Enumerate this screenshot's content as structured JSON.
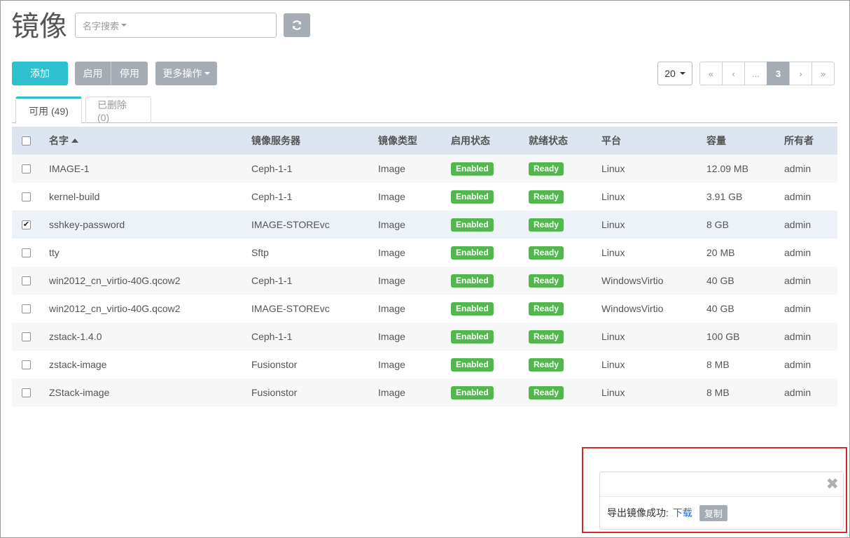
{
  "header": {
    "title": "镜像",
    "search_placeholder": "名字搜索",
    "refresh_icon": "refresh-icon"
  },
  "toolbar": {
    "add_label": "添加",
    "enable_label": "启用",
    "disable_label": "停用",
    "more_label": "更多操作"
  },
  "pagination": {
    "page_size": "20",
    "first": "«",
    "prev": "‹",
    "ellipsis": "...",
    "current": "3",
    "next": "›",
    "last": "»"
  },
  "tabs": [
    {
      "label": "可用 (49)",
      "active": true
    },
    {
      "label": "已删除 (0)",
      "active": false
    }
  ],
  "table": {
    "columns": [
      "名字",
      "镜像服务器",
      "镜像类型",
      "启用状态",
      "就绪状态",
      "平台",
      "容量",
      "所有者"
    ],
    "rows": [
      {
        "name": "IMAGE-1",
        "server": "Ceph-1-1",
        "type": "Image",
        "state": "Enabled",
        "status": "Ready",
        "platform": "Linux",
        "size": "12.09 MB",
        "owner": "admin",
        "checked": false
      },
      {
        "name": "kernel-build",
        "server": "Ceph-1-1",
        "type": "Image",
        "state": "Enabled",
        "status": "Ready",
        "platform": "Linux",
        "size": "3.91 GB",
        "owner": "admin",
        "checked": false
      },
      {
        "name": "sshkey-password",
        "server": "IMAGE-STOREvc",
        "type": "Image",
        "state": "Enabled",
        "status": "Ready",
        "platform": "Linux",
        "size": "8 GB",
        "owner": "admin",
        "checked": true
      },
      {
        "name": "tty",
        "server": "Sftp",
        "type": "Image",
        "state": "Enabled",
        "status": "Ready",
        "platform": "Linux",
        "size": "20 MB",
        "owner": "admin",
        "checked": false
      },
      {
        "name": "win2012_cn_virtio-40G.qcow2",
        "server": "Ceph-1-1",
        "type": "Image",
        "state": "Enabled",
        "status": "Ready",
        "platform": "WindowsVirtio",
        "size": "40 GB",
        "owner": "admin",
        "checked": false
      },
      {
        "name": "win2012_cn_virtio-40G.qcow2",
        "server": "IMAGE-STOREvc",
        "type": "Image",
        "state": "Enabled",
        "status": "Ready",
        "platform": "WindowsVirtio",
        "size": "40 GB",
        "owner": "admin",
        "checked": false
      },
      {
        "name": "zstack-1.4.0",
        "server": "Ceph-1-1",
        "type": "Image",
        "state": "Enabled",
        "status": "Ready",
        "platform": "Linux",
        "size": "100 GB",
        "owner": "admin",
        "checked": false
      },
      {
        "name": "zstack-image",
        "server": "Fusionstor",
        "type": "Image",
        "state": "Enabled",
        "status": "Ready",
        "platform": "Linux",
        "size": "8 MB",
        "owner": "admin",
        "checked": false
      },
      {
        "name": "ZStack-image",
        "server": "Fusionstor",
        "type": "Image",
        "state": "Enabled",
        "status": "Ready",
        "platform": "Linux",
        "size": "8 MB",
        "owner": "admin",
        "checked": false
      }
    ]
  },
  "toast": {
    "message": "导出镜像成功:",
    "download_label": "下载",
    "copy_label": "复制",
    "close_glyph": "✖"
  },
  "colors": {
    "accent": "#2fc0d0",
    "button_gray": "#a6acb3",
    "badge_green": "#52b84e",
    "header_bg": "#dde6f0",
    "highlight_red": "#d12b2b",
    "link_blue": "#2a6cc7"
  }
}
